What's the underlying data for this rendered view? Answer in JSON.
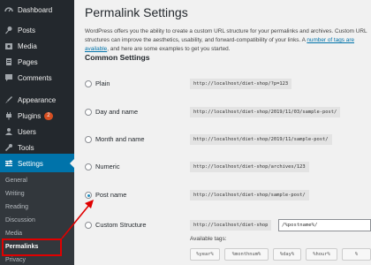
{
  "sidebar": {
    "items": [
      {
        "label": "Dashboard",
        "icon": "dashboard-icon"
      },
      {
        "label": "Posts",
        "icon": "pin-icon"
      },
      {
        "label": "Media",
        "icon": "media-icon"
      },
      {
        "label": "Pages",
        "icon": "page-icon"
      },
      {
        "label": "Comments",
        "icon": "comment-icon"
      },
      {
        "label": "Appearance",
        "icon": "brush-icon"
      },
      {
        "label": "Plugins",
        "icon": "plug-icon",
        "badge": "2"
      },
      {
        "label": "Users",
        "icon": "user-icon"
      },
      {
        "label": "Tools",
        "icon": "wrench-icon"
      },
      {
        "label": "Settings",
        "icon": "settings-icon"
      }
    ],
    "submenu": [
      "General",
      "Writing",
      "Reading",
      "Discussion",
      "Media",
      "Permalinks",
      "Privacy"
    ],
    "active_item": "Settings",
    "current_submenu": "Permalinks"
  },
  "main": {
    "title": "Permalink Settings",
    "intro_1": "WordPress offers you the ability to create a custom URL structure for your permalinks and archives. Custom URL structures can improve the aesthetics, usability, and forward-compatibility of your",
    "intro_2": "links. A ",
    "intro_link": "number of tags are available",
    "intro_3": ", and here are some examples to get you started.",
    "section_title": "Common Settings",
    "options": [
      {
        "label": "Plain",
        "example": "http://localhost/diet-shop/?p=123",
        "checked": false
      },
      {
        "label": "Day and name",
        "example": "http://localhost/diet-shop/2019/11/03/sample-post/",
        "checked": false
      },
      {
        "label": "Month and name",
        "example": "http://localhost/diet-shop/2019/11/sample-post/",
        "checked": false
      },
      {
        "label": "Numeric",
        "example": "http://localhost/diet-shop/archives/123",
        "checked": false
      },
      {
        "label": "Post name",
        "example": "http://localhost/diet-shop/sample-post/",
        "checked": true
      },
      {
        "label": "Custom Structure",
        "example": "http://localhost/diet-shop",
        "checked": false
      }
    ],
    "custom_value": "/%postname%/",
    "tags_label": "Available tags:",
    "tags": [
      "%year%",
      "%monthnum%",
      "%day%",
      "%hour%",
      "%"
    ]
  },
  "colors": {
    "sidebar_bg": "#23282d",
    "submenu_bg": "#32373c",
    "accent": "#0073aa",
    "annotation": "#e00000"
  }
}
